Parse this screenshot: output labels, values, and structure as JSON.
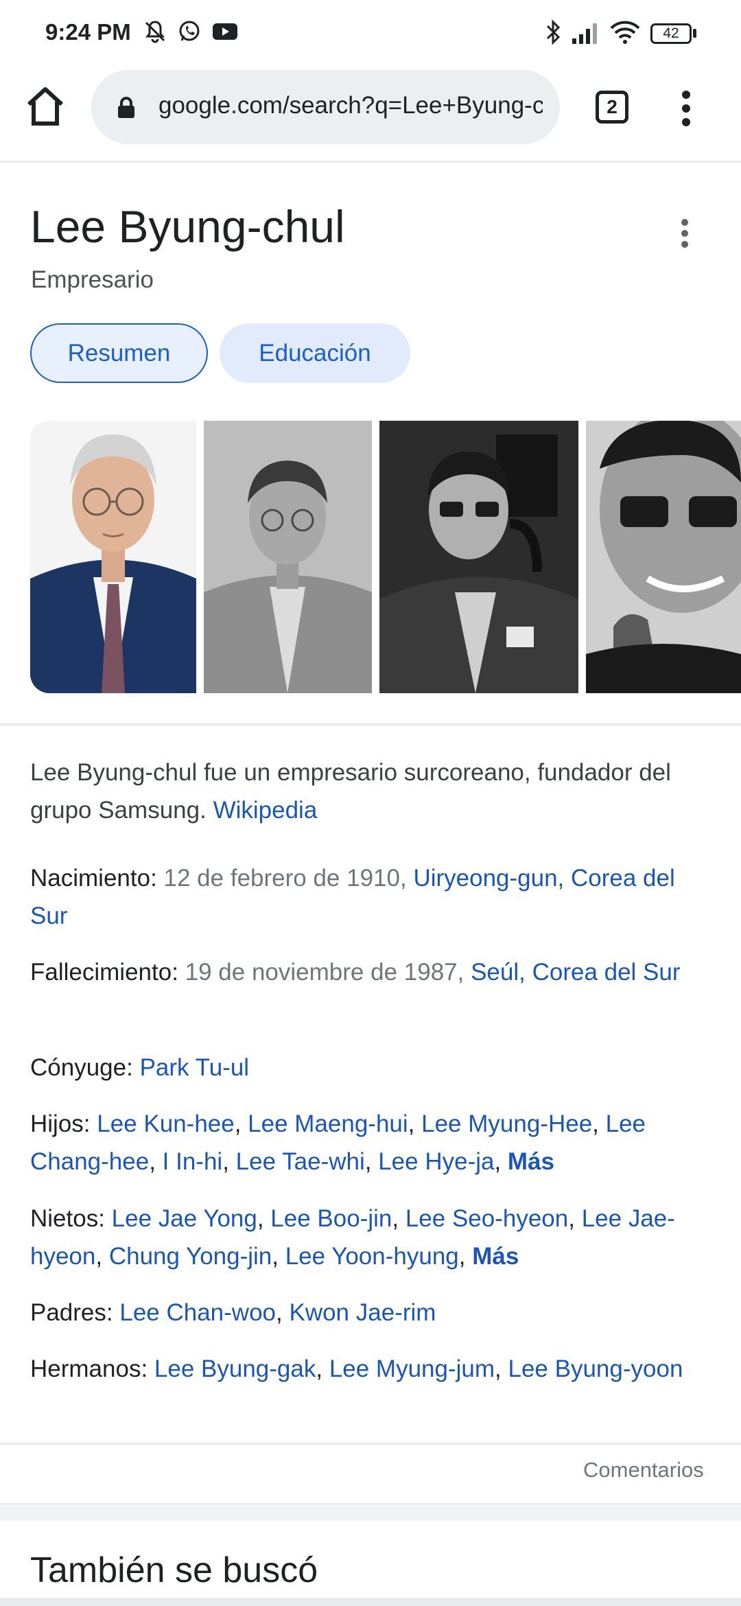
{
  "status": {
    "time": "9:24 PM",
    "battery": "42"
  },
  "browser": {
    "url": "google.com/search?q=Lee+Byung-chul",
    "tab_count": "2"
  },
  "panel": {
    "title": "Lee Byung-chul",
    "subtitle": "Empresario",
    "chips": [
      "Resumen",
      "Educación"
    ],
    "description": "Lee Byung-chul fue un empresario surcoreano, fundador del grupo Samsung.",
    "description_source": "Wikipedia",
    "facts": {
      "birth": {
        "label": "Nacimiento:",
        "date": "12 de febrero de 1910,",
        "place": "Uiryeong-gun, Corea del Sur"
      },
      "death": {
        "label": "Fallecimiento:",
        "date": "19 de noviembre de 1987,",
        "place": "Seúl, Corea del Sur"
      },
      "spouse": {
        "label": "Cónyuge:",
        "name": "Park Tu-ul"
      },
      "children": {
        "label": "Hijos:",
        "names": [
          "Lee Kun-hee",
          "Lee Maeng-hui",
          "Lee Myung-Hee",
          "Lee Chang-hee",
          "I In-hi",
          "Lee Tae-whi",
          "Lee Hye-ja"
        ],
        "more": "Más"
      },
      "grandchildren": {
        "label": "Nietos:",
        "names": [
          "Lee Jae Yong",
          "Lee Boo-jin",
          "Lee Seo-hyeon",
          "Lee Jae-hyeon",
          "Chung Yong-jin",
          "Lee Yoon-hyung"
        ],
        "more": "Más"
      },
      "parents": {
        "label": "Padres:",
        "names": [
          "Lee Chan-woo",
          "Kwon Jae-rim"
        ]
      },
      "siblings": {
        "label": "Hermanos:",
        "names": [
          "Lee Byung-gak",
          "Lee Myung-jum",
          "Lee Byung-yoon"
        ]
      }
    },
    "feedback": "Comentarios",
    "also_searched": "También se buscó"
  }
}
